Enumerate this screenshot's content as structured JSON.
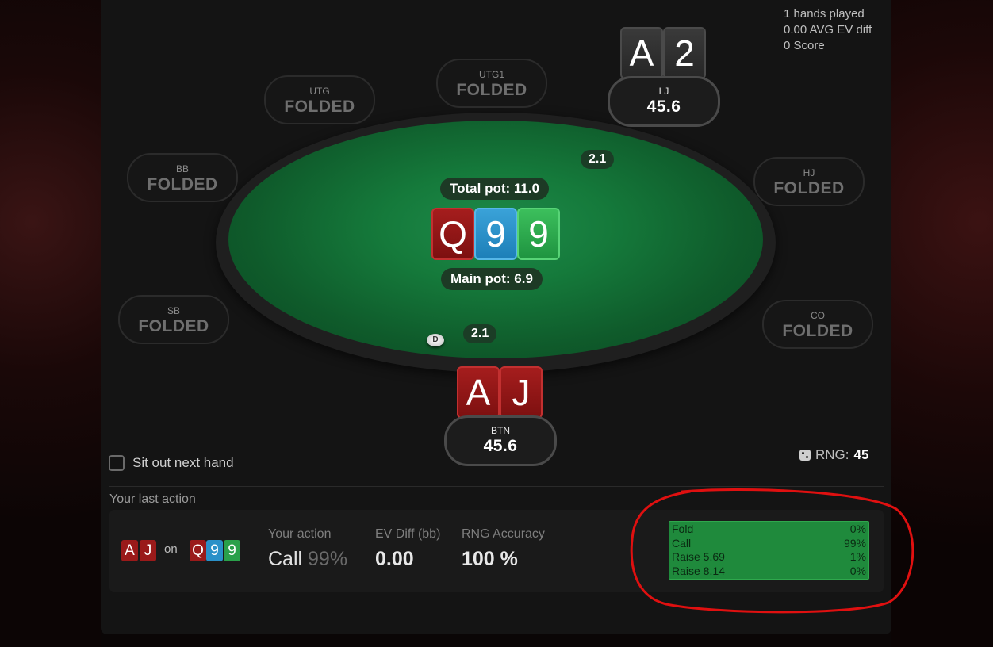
{
  "stats": {
    "hands_played": "1 hands played",
    "avg_ev_diff": "0.00 AVG EV diff",
    "score": "0 Score"
  },
  "seats": {
    "utg": {
      "position": "UTG",
      "status": "FOLDED"
    },
    "utg1": {
      "position": "UTG1",
      "status": "FOLDED"
    },
    "lj": {
      "position": "LJ",
      "stack": "45.6",
      "cards": [
        "A",
        "2"
      ]
    },
    "hj": {
      "position": "HJ",
      "status": "FOLDED"
    },
    "co": {
      "position": "CO",
      "status": "FOLDED"
    },
    "btn": {
      "position": "BTN",
      "stack": "45.6",
      "cards": [
        "A",
        "J"
      ]
    },
    "sb": {
      "position": "SB",
      "status": "FOLDED"
    },
    "bb": {
      "position": "BB",
      "status": "FOLDED"
    }
  },
  "table": {
    "total_pot": "Total pot: 11.0",
    "main_pot": "Main pot: 6.9",
    "board": [
      "Q",
      "9",
      "9"
    ],
    "lj_bet": "2.1",
    "btn_bet": "2.1",
    "dealer_button": "D"
  },
  "controls": {
    "sit_out_label": "Sit out next hand",
    "rng_label": "RNG:",
    "rng_value": "45"
  },
  "last_action": {
    "section_label": "Your last action",
    "hand": [
      "A",
      "J"
    ],
    "on_label": "on",
    "board": [
      "Q",
      "9",
      "9"
    ],
    "your_action_header": "Your action",
    "your_action_value": "Call",
    "your_action_pct": "99%",
    "ev_diff_header": "EV Diff (bb)",
    "ev_diff_value": "0.00",
    "rng_accuracy_header": "RNG Accuracy",
    "rng_accuracy_value": "100 %"
  },
  "strategy": [
    {
      "action": "Fold",
      "pct": "0%"
    },
    {
      "action": "Call",
      "pct": "99%"
    },
    {
      "action": "Raise 5.69",
      "pct": "1%"
    },
    {
      "action": "Raise 8.14",
      "pct": "0%"
    }
  ],
  "colors": {
    "felt": "#157a3b",
    "heart_card": "#9a1a1a",
    "diamond_card": "#2a90c8",
    "club_card": "#2aa04a",
    "annotation": "#e01010"
  }
}
